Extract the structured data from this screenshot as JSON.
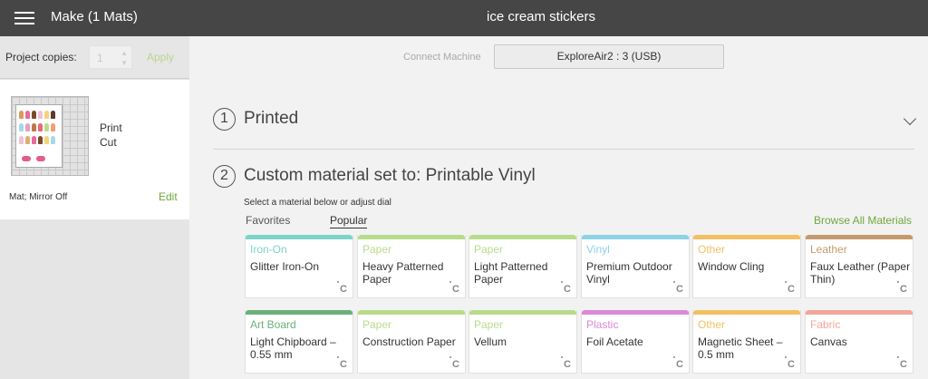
{
  "header": {
    "left_title": "Make (1 Mats)",
    "project_name": "ice cream stickers",
    "menu_icon": "hamburger-menu-icon"
  },
  "sidebar": {
    "project_copies_label": "Project copies:",
    "copies_value": "1",
    "apply_label": "Apply",
    "mat": {
      "type_print": "Print",
      "type_cut": "Cut",
      "status": "Mat; Mirror Off",
      "edit_label": "Edit"
    }
  },
  "main": {
    "connect_label": "Connect Machine",
    "machine_name": "ExploreAir2 : 3 (USB)",
    "step1": {
      "number": "1",
      "title": "Printed"
    },
    "step2": {
      "number": "2",
      "title": "Custom material set to: Printable Vinyl",
      "hint": "Select a material below or adjust dial"
    },
    "tabs": [
      {
        "label": "Favorites",
        "active": false
      },
      {
        "label": "Popular",
        "active": true
      }
    ],
    "browse_all_label": "Browse All Materials",
    "dial_mark": "C",
    "materials": [
      {
        "category": "Iron-On",
        "name": "Glitter Iron-On",
        "color": "#7dd3c8"
      },
      {
        "category": "Paper",
        "name": "Heavy Patterned Paper",
        "color": "#b8dc8a"
      },
      {
        "category": "Paper",
        "name": "Light Patterned Paper",
        "color": "#b8dc8a"
      },
      {
        "category": "Vinyl",
        "name": "Premium Outdoor Vinyl",
        "color": "#8ad3e8"
      },
      {
        "category": "Other",
        "name": "Window Cling",
        "color": "#f2c063"
      },
      {
        "category": "Leather",
        "name": "Faux Leather (Paper Thin)",
        "color": "#c49a6c"
      },
      {
        "category": "Art Board",
        "name": "Light Chipboard – 0.55 mm",
        "color": "#6ab07a"
      },
      {
        "category": "Paper",
        "name": "Construction Paper",
        "color": "#b8dc8a"
      },
      {
        "category": "Paper",
        "name": "Vellum",
        "color": "#b8dc8a"
      },
      {
        "category": "Plastic",
        "name": "Foil Acetate",
        "color": "#d98ad8"
      },
      {
        "category": "Other",
        "name": "Magnetic Sheet – 0.5 mm",
        "color": "#f2c063"
      },
      {
        "category": "Fabric",
        "name": "Canvas",
        "color": "#f1a79b"
      }
    ]
  }
}
